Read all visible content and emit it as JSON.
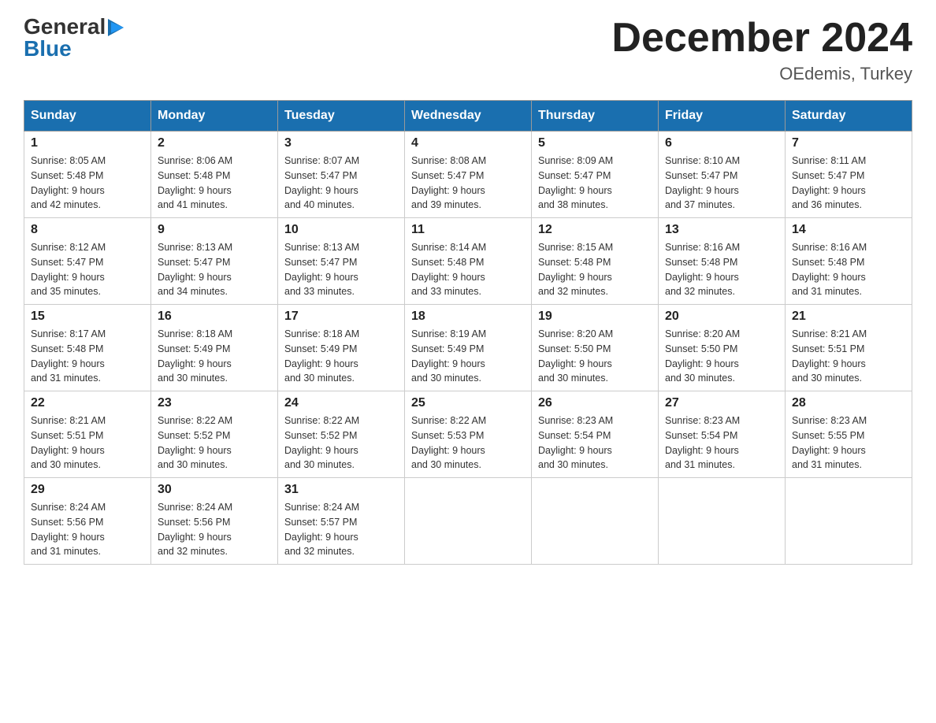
{
  "logo": {
    "general": "General",
    "blue": "Blue"
  },
  "title": "December 2024",
  "location": "OEdemis, Turkey",
  "days_of_week": [
    "Sunday",
    "Monday",
    "Tuesday",
    "Wednesday",
    "Thursday",
    "Friday",
    "Saturday"
  ],
  "weeks": [
    [
      {
        "day": "1",
        "sunrise": "8:05 AM",
        "sunset": "5:48 PM",
        "daylight": "9 hours and 42 minutes."
      },
      {
        "day": "2",
        "sunrise": "8:06 AM",
        "sunset": "5:48 PM",
        "daylight": "9 hours and 41 minutes."
      },
      {
        "day": "3",
        "sunrise": "8:07 AM",
        "sunset": "5:47 PM",
        "daylight": "9 hours and 40 minutes."
      },
      {
        "day": "4",
        "sunrise": "8:08 AM",
        "sunset": "5:47 PM",
        "daylight": "9 hours and 39 minutes."
      },
      {
        "day": "5",
        "sunrise": "8:09 AM",
        "sunset": "5:47 PM",
        "daylight": "9 hours and 38 minutes."
      },
      {
        "day": "6",
        "sunrise": "8:10 AM",
        "sunset": "5:47 PM",
        "daylight": "9 hours and 37 minutes."
      },
      {
        "day": "7",
        "sunrise": "8:11 AM",
        "sunset": "5:47 PM",
        "daylight": "9 hours and 36 minutes."
      }
    ],
    [
      {
        "day": "8",
        "sunrise": "8:12 AM",
        "sunset": "5:47 PM",
        "daylight": "9 hours and 35 minutes."
      },
      {
        "day": "9",
        "sunrise": "8:13 AM",
        "sunset": "5:47 PM",
        "daylight": "9 hours and 34 minutes."
      },
      {
        "day": "10",
        "sunrise": "8:13 AM",
        "sunset": "5:47 PM",
        "daylight": "9 hours and 33 minutes."
      },
      {
        "day": "11",
        "sunrise": "8:14 AM",
        "sunset": "5:48 PM",
        "daylight": "9 hours and 33 minutes."
      },
      {
        "day": "12",
        "sunrise": "8:15 AM",
        "sunset": "5:48 PM",
        "daylight": "9 hours and 32 minutes."
      },
      {
        "day": "13",
        "sunrise": "8:16 AM",
        "sunset": "5:48 PM",
        "daylight": "9 hours and 32 minutes."
      },
      {
        "day": "14",
        "sunrise": "8:16 AM",
        "sunset": "5:48 PM",
        "daylight": "9 hours and 31 minutes."
      }
    ],
    [
      {
        "day": "15",
        "sunrise": "8:17 AM",
        "sunset": "5:48 PM",
        "daylight": "9 hours and 31 minutes."
      },
      {
        "day": "16",
        "sunrise": "8:18 AM",
        "sunset": "5:49 PM",
        "daylight": "9 hours and 30 minutes."
      },
      {
        "day": "17",
        "sunrise": "8:18 AM",
        "sunset": "5:49 PM",
        "daylight": "9 hours and 30 minutes."
      },
      {
        "day": "18",
        "sunrise": "8:19 AM",
        "sunset": "5:49 PM",
        "daylight": "9 hours and 30 minutes."
      },
      {
        "day": "19",
        "sunrise": "8:20 AM",
        "sunset": "5:50 PM",
        "daylight": "9 hours and 30 minutes."
      },
      {
        "day": "20",
        "sunrise": "8:20 AM",
        "sunset": "5:50 PM",
        "daylight": "9 hours and 30 minutes."
      },
      {
        "day": "21",
        "sunrise": "8:21 AM",
        "sunset": "5:51 PM",
        "daylight": "9 hours and 30 minutes."
      }
    ],
    [
      {
        "day": "22",
        "sunrise": "8:21 AM",
        "sunset": "5:51 PM",
        "daylight": "9 hours and 30 minutes."
      },
      {
        "day": "23",
        "sunrise": "8:22 AM",
        "sunset": "5:52 PM",
        "daylight": "9 hours and 30 minutes."
      },
      {
        "day": "24",
        "sunrise": "8:22 AM",
        "sunset": "5:52 PM",
        "daylight": "9 hours and 30 minutes."
      },
      {
        "day": "25",
        "sunrise": "8:22 AM",
        "sunset": "5:53 PM",
        "daylight": "9 hours and 30 minutes."
      },
      {
        "day": "26",
        "sunrise": "8:23 AM",
        "sunset": "5:54 PM",
        "daylight": "9 hours and 30 minutes."
      },
      {
        "day": "27",
        "sunrise": "8:23 AM",
        "sunset": "5:54 PM",
        "daylight": "9 hours and 31 minutes."
      },
      {
        "day": "28",
        "sunrise": "8:23 AM",
        "sunset": "5:55 PM",
        "daylight": "9 hours and 31 minutes."
      }
    ],
    [
      {
        "day": "29",
        "sunrise": "8:24 AM",
        "sunset": "5:56 PM",
        "daylight": "9 hours and 31 minutes."
      },
      {
        "day": "30",
        "sunrise": "8:24 AM",
        "sunset": "5:56 PM",
        "daylight": "9 hours and 32 minutes."
      },
      {
        "day": "31",
        "sunrise": "8:24 AM",
        "sunset": "5:57 PM",
        "daylight": "9 hours and 32 minutes."
      },
      null,
      null,
      null,
      null
    ]
  ],
  "labels": {
    "sunrise": "Sunrise:",
    "sunset": "Sunset:",
    "daylight": "Daylight:"
  }
}
